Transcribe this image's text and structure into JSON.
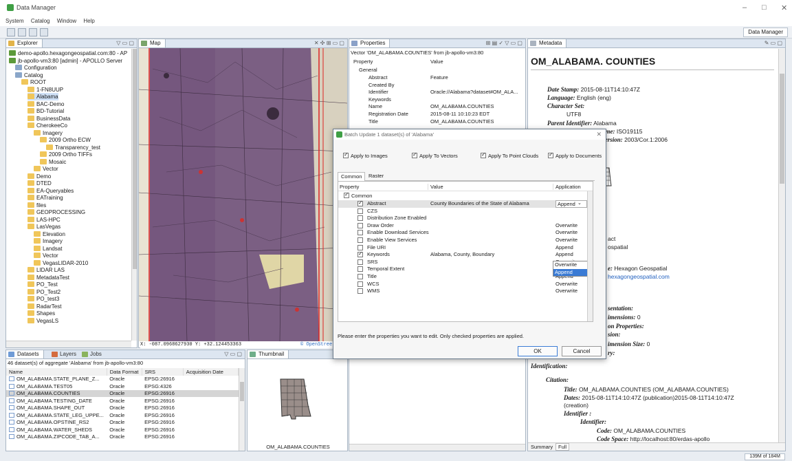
{
  "window": {
    "title": "Data Manager",
    "controls": [
      "–",
      "□",
      "✕"
    ]
  },
  "menubar": [
    "System",
    "Catalog",
    "Window",
    "Help"
  ],
  "toolbar": {
    "perspective": "Data Manager"
  },
  "explorer": {
    "tab": "Explorer",
    "items": [
      {
        "label": "demo-apollo.hexagongeospatial.com:80 - AP",
        "lvl": 0
      },
      {
        "label": "jb-apollo-vm3:80 [admin] - APOLLO Server",
        "lvl": 0
      },
      {
        "label": "Configuration",
        "lvl": 1
      },
      {
        "label": "Catalog",
        "lvl": 1
      },
      {
        "label": "ROOT",
        "lvl": 2
      },
      {
        "label": "1-FN8UUP",
        "lvl": 3
      },
      {
        "label": "Alabama",
        "lvl": 3,
        "sel": true
      },
      {
        "label": "BAC-Demo",
        "lvl": 3
      },
      {
        "label": "BD-Tutorial",
        "lvl": 3
      },
      {
        "label": "BusinessData",
        "lvl": 3
      },
      {
        "label": "CherokeeCo",
        "lvl": 3
      },
      {
        "label": "Imagery",
        "lvl": 4
      },
      {
        "label": "2009 Ortho ECW",
        "lvl": 5
      },
      {
        "label": "Transparency_test",
        "lvl": 6
      },
      {
        "label": "2009 Ortho TIFFs",
        "lvl": 5
      },
      {
        "label": "Mosaic",
        "lvl": 5
      },
      {
        "label": "Vector",
        "lvl": 4
      },
      {
        "label": "Demo",
        "lvl": 3
      },
      {
        "label": "DTED",
        "lvl": 3
      },
      {
        "label": "EA-Queryables",
        "lvl": 3
      },
      {
        "label": "EATraining",
        "lvl": 3
      },
      {
        "label": "files",
        "lvl": 3
      },
      {
        "label": "GEOPROCESSING",
        "lvl": 3
      },
      {
        "label": "LAS-HPC",
        "lvl": 3
      },
      {
        "label": "LasVegas",
        "lvl": 3
      },
      {
        "label": "Elevation",
        "lvl": 4
      },
      {
        "label": "Imagery",
        "lvl": 4
      },
      {
        "label": "Landsat",
        "lvl": 4
      },
      {
        "label": "Vector",
        "lvl": 4
      },
      {
        "label": "VegasLIDAR-2010",
        "lvl": 4
      },
      {
        "label": "LIDAR LAS",
        "lvl": 3
      },
      {
        "label": "MetadataTest",
        "lvl": 3
      },
      {
        "label": "PO_Test",
        "lvl": 3
      },
      {
        "label": "PO_Test2",
        "lvl": 3
      },
      {
        "label": "PO_test3",
        "lvl": 3
      },
      {
        "label": "RadarTest",
        "lvl": 3
      },
      {
        "label": "Shapes",
        "lvl": 3
      },
      {
        "label": "VegasLS",
        "lvl": 3
      }
    ]
  },
  "map": {
    "tab": "Map",
    "coords": "X: -087.0968627930  Y: +32.124453363",
    "credit": "© OpenStreetMap"
  },
  "datasets": {
    "tabs": [
      "Datasets",
      "Layers",
      "Jobs"
    ],
    "summary": "46 dataset(s) of aggregate 'Alabama' from jb-apollo-vm3:80",
    "columns": [
      "Name",
      "Data Format",
      "SRS",
      "Acquisition Date"
    ],
    "rows": [
      [
        "OM_ALABAMA.STATE_PLANE_Z...",
        "Oracle",
        "EPSG:26916",
        ""
      ],
      [
        "OM_ALABAMA.TEST05",
        "Oracle",
        "EPSG:4326",
        ""
      ],
      [
        "OM_ALABAMA.COUNTIES",
        "Oracle",
        "EPSG:26916",
        ""
      ],
      [
        "OM_ALABAMA.TESTING_DATE",
        "Oracle",
        "EPSG:26916",
        ""
      ],
      [
        "OM_ALABAMA.SHAPE_OUT",
        "Oracle",
        "EPSG:26916",
        ""
      ],
      [
        "OM_ALABAMA.STATE_LEG_UPPE...",
        "Oracle",
        "EPSG:26916",
        ""
      ],
      [
        "OM_ALABAMA.OPSTINE_RS2",
        "Oracle",
        "EPSG:26916",
        ""
      ],
      [
        "OM_ALABAMA.WATER_SHEDS",
        "Oracle",
        "EPSG:26916",
        ""
      ],
      [
        "OM_ALABAMA.ZIPCODE_TAB_A...",
        "Oracle",
        "EPSG:26916",
        ""
      ]
    ]
  },
  "thumbnail": {
    "tab": "Thumbnail",
    "caption": "OM_ALABAMA.COUNTIES"
  },
  "properties": {
    "tab": "Properties",
    "header": "Vector 'OM_ALABAMA.COUNTIES' from jb-apollo-vm3:80",
    "columns": [
      "Property",
      "Value"
    ],
    "group": "General",
    "rows": [
      [
        "Abstract",
        "Feature"
      ],
      [
        "Created By",
        ""
      ],
      [
        "Identifier",
        "Oracle://Alabama?dataset#OM_ALA..."
      ],
      [
        "Keywords",
        ""
      ],
      [
        "Name",
        "OM_ALABAMA.COUNTIES"
      ],
      [
        "Registration Date",
        "2015-08-11 10:10:23 EDT"
      ],
      [
        "Title",
        "OM_ALABAMA.COUNTIES"
      ]
    ]
  },
  "dialog": {
    "title": "Batch Update 1 dataset(s) of 'Alabama'",
    "apply": [
      {
        "label": "Apply to Images",
        "on": true
      },
      {
        "label": "Apply To Vectors",
        "on": true
      },
      {
        "label": "Apply To Point Clouds",
        "on": true
      },
      {
        "label": "Apply to Documents",
        "on": true
      }
    ],
    "tabs": [
      "Common",
      "Raster"
    ],
    "columns": [
      "Property",
      "Value",
      "Application"
    ],
    "group": "Common",
    "rows": [
      {
        "p": "Abstract",
        "on": true,
        "v": "County Boundaries of the State of Alabama",
        "a": "Append"
      },
      {
        "p": "CZS",
        "on": false,
        "v": "",
        "a": ""
      },
      {
        "p": "Distribution Zone Enabled",
        "on": false,
        "v": "",
        "a": ""
      },
      {
        "p": "Draw Order",
        "on": false,
        "v": "",
        "a": "Overwrite"
      },
      {
        "p": "Enable Download Services",
        "on": false,
        "v": "",
        "a": "Overwrite"
      },
      {
        "p": "Enable View Services",
        "on": false,
        "v": "",
        "a": "Overwrite"
      },
      {
        "p": "File URI",
        "on": false,
        "v": "",
        "a": "Append"
      },
      {
        "p": "Keywords",
        "on": true,
        "v": "Alabama, County, Boundary",
        "a": "Append"
      },
      {
        "p": "SRS",
        "on": false,
        "v": "",
        "a": "Overwrite"
      },
      {
        "p": "Temporal Extent",
        "on": false,
        "v": "",
        "a": "Overwrite"
      },
      {
        "p": "Title",
        "on": false,
        "v": "",
        "a": "Append"
      },
      {
        "p": "WCS",
        "on": false,
        "v": "",
        "a": "Overwrite"
      },
      {
        "p": "WMS",
        "on": false,
        "v": "",
        "a": "Overwrite"
      }
    ],
    "dropdown": [
      "Overwrite",
      "Append"
    ],
    "hint": "Please enter the properties you want to edit. Only checked properties are applied.",
    "ok": "OK",
    "cancel": "Cancel"
  },
  "metadata": {
    "tab": "Metadata",
    "title": "OM_ALABAMA. COUNTIES",
    "top": [
      {
        "k": "Date Stamp:",
        "v": "2015-08-11T14:10:47Z"
      },
      {
        "k": "Language:",
        "v": "English (eng)"
      },
      {
        "k": "Character Set:",
        "v": ""
      },
      {
        "k": "",
        "v": "UTF8"
      },
      {
        "k": "Parent Identifier:",
        "v": "Alabama"
      },
      {
        "k": "Metadata Standard Name:",
        "v": "ISO19115"
      },
      {
        "k": "d Version:",
        "v": "2003/Cor.1:2006"
      }
    ],
    "partial": [
      {
        "k": "",
        "v": "act"
      },
      {
        "k": "",
        "v": "ospatial"
      },
      {
        "k": "e:",
        "v": "Hexagon Geospatial"
      },
      {
        "k": "",
        "v": "hexagongeospatial.com"
      },
      {
        "k": "sentation:",
        "v": ""
      },
      {
        "k": "imensions:",
        "v": "0"
      },
      {
        "k": "on Properties:",
        "v": ""
      },
      {
        "k": "sion:",
        "v": ""
      },
      {
        "k": "imension Size:",
        "v": "0"
      },
      {
        "k": "ry:",
        "v": ""
      }
    ],
    "ident": "Identification:",
    "citation": "Citation:",
    "titleK": "Title:",
    "titleV": "OM_ALABAMA.COUNTIES (OM_ALABAMA.COUNTIES)",
    "datesK": "Dates:",
    "datesV": "2015-08-11T14:10:47Z (publication)2015-08-11T14:10:47Z",
    "datesV2": "(creation)",
    "idK": "Identifier :",
    "id2K": "Identifier:",
    "codeK": "Code:",
    "codeV": "OM_ALABAMA.COUNTIES",
    "csK": "Code Space:",
    "csV": "http://localhost:80/erdas-apollo",
    "tabs": [
      "Summary",
      "Full"
    ]
  },
  "status": {
    "memory": "139M of 184M"
  },
  "colors": {
    "accent": "#3a7bd5",
    "map": "#7b5f83",
    "select": "#cfe1f7",
    "link": "#1f5fbf"
  }
}
